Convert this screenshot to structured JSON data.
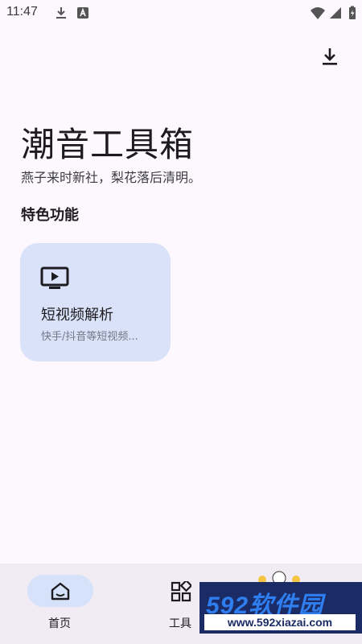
{
  "status_bar": {
    "time": "11:47"
  },
  "header": {
    "title": "潮音工具箱",
    "subtitle": "燕子来时新社，梨花落后清明。"
  },
  "section": {
    "title": "特色功能"
  },
  "features": [
    {
      "title": "短视频解析",
      "description": "快手/抖音等短视频...",
      "icon": "tv-play-icon"
    }
  ],
  "bottom_nav": {
    "items": [
      {
        "label": "首页",
        "icon": "home-icon",
        "selected": true
      },
      {
        "label": "工具",
        "icon": "grid-apps-icon",
        "selected": false
      }
    ]
  },
  "watermark": {
    "brand": "592软件园",
    "url": "www.592xiazai.com"
  },
  "colors": {
    "background": "#fdf8fd",
    "card": "#d9e2f8",
    "nav_bar": "#f1ecf4",
    "nav_selected_pill": "#d6e1fa",
    "watermark_bg": "#1b2b66",
    "watermark_text": "#2f7ef0"
  }
}
